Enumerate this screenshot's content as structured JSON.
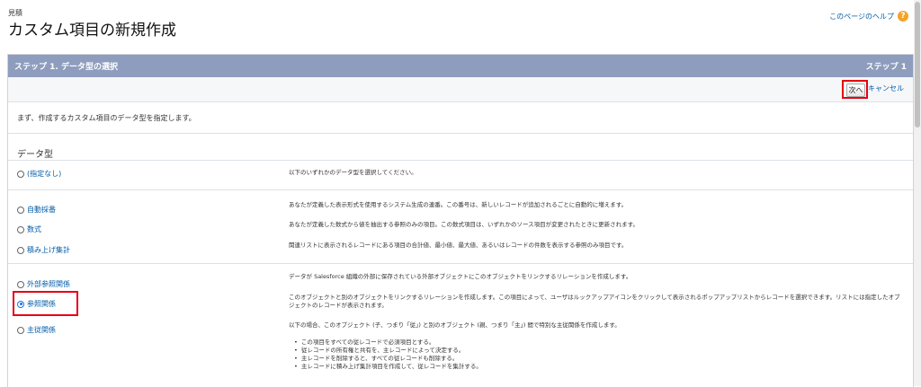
{
  "header": {
    "object_label": "見積",
    "title": "カスタム項目の新規作成",
    "help_link": "このページのヘルプ"
  },
  "step": {
    "title": "ステップ 1. データ型の選択",
    "counter": "ステップ 1"
  },
  "buttons": {
    "next": "次へ",
    "cancel": "キャンセル"
  },
  "instruction": "まず、作成するカスタム項目のデータ型を指定します。",
  "section_title": "データ型",
  "options": [
    {
      "label": "(指定なし)",
      "selected": false
    },
    {
      "label": "自動採番",
      "selected": false
    },
    {
      "label": "数式",
      "selected": false
    },
    {
      "label": "積み上げ集計",
      "selected": false
    },
    {
      "label": "外部参照関係",
      "selected": false
    },
    {
      "label": "参照関係",
      "selected": true
    },
    {
      "label": "主従関係",
      "selected": false
    }
  ],
  "descriptions": {
    "none": "以下のいずれかのデータ型を選択してください。",
    "autonumber": "あなたが定義した表示形式を使用するシステム生成の連番。この番号は、新しいレコードが追加されるごとに自動的に増えます。",
    "formula": "あなたが定義した数式から値を抽出する参照のみの項目。この数式項目は、いずれかのソース項目が変更されたときに更新されます。",
    "rollup": "関連リストに表示されるレコードにある項目の合計値、最小値、最大値、あるいはレコードの件数を表示する参照のみ項目です。",
    "external": "データが Salesforce 組織の外部に保存されている外部オブジェクトにこのオブジェクトをリンクするリレーションを作成します。",
    "lookup": "このオブジェクトと別のオブジェクトをリンクするリレーションを作成します。この項目によって、ユーザはルックアップアイコンをクリックして表示されるポップアップリストからレコードを選択できます。リストには指定したオブジェクトのレコードが表示されます。",
    "master_detail": "以下の場合、このオブジェクト (子、つまり「従」) と別のオブジェクト (親、つまり「主」) 間で特別な主従関係を作成します。",
    "master_detail_bullets": [
      "この項目をすべての従レコードで必須項目とする。",
      "従レコードの所有権と共有を、主レコードによって決定する。",
      "主レコードを削除すると、すべての従レコードも削除する。",
      "主レコードに積み上げ集計項目を作成して、従レコードを集計する。"
    ]
  },
  "colors": {
    "header_bar": "#8e9dbe",
    "link": "#015ba7",
    "highlight": "#e60012",
    "help_icon": "#f4a32a"
  }
}
